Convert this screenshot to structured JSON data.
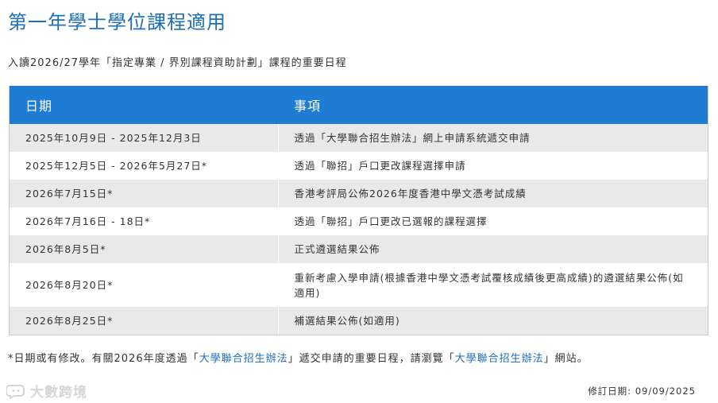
{
  "page": {
    "title": "第一年學士學位課程適用",
    "subtitle": "入讀2026/27學年「指定專業 / 界別課程資助計劃」課程的重要日程"
  },
  "table": {
    "headers": {
      "date": "日期",
      "event": "事項"
    },
    "rows": [
      {
        "date": "2025年10月9日 - 2025年12月3日",
        "event": "透過「大學聯合招生辦法」網上申請系統遞交申請"
      },
      {
        "date": "2025年12月5日 - 2026年5月27日*",
        "event": "透過「聯招」戶口更改課程選擇申請"
      },
      {
        "date": "2026年7月15日*",
        "event": "香港考評局公佈2026年度香港中學文憑考試成績"
      },
      {
        "date": "2026年7月16日 - 18日*",
        "event": "透過「聯招」戶口更改已選報的課程選擇"
      },
      {
        "date": "2026年8月5日*",
        "event": "正式遴選結果公佈"
      },
      {
        "date": "2026年8月20日*",
        "event": "重新考慮入學申請(根據香港中學文憑考試覆核成績後更高成績)的遴選結果公佈(如適用)"
      },
      {
        "date": "2026年8月25日*",
        "event": "補選結果公佈(如適用)"
      }
    ]
  },
  "footnote": {
    "part1": "*日期或有修改。有關2026年度透過「",
    "link1": "大學聯合招生辦法",
    "part2": "」遞交申請的重要日程，請瀏覽「",
    "link2": "大學聯合招生辦法",
    "part3": "」網站。"
  },
  "watermark": {
    "text": "大數跨境",
    "icon": "speech-bubble-logo-icon"
  },
  "revised": "修訂日期: 09/09/2025",
  "colors": {
    "accent": "#1f6fb8",
    "header_bg": "#1f7cd3",
    "row_alt": "#e9e9e9"
  }
}
